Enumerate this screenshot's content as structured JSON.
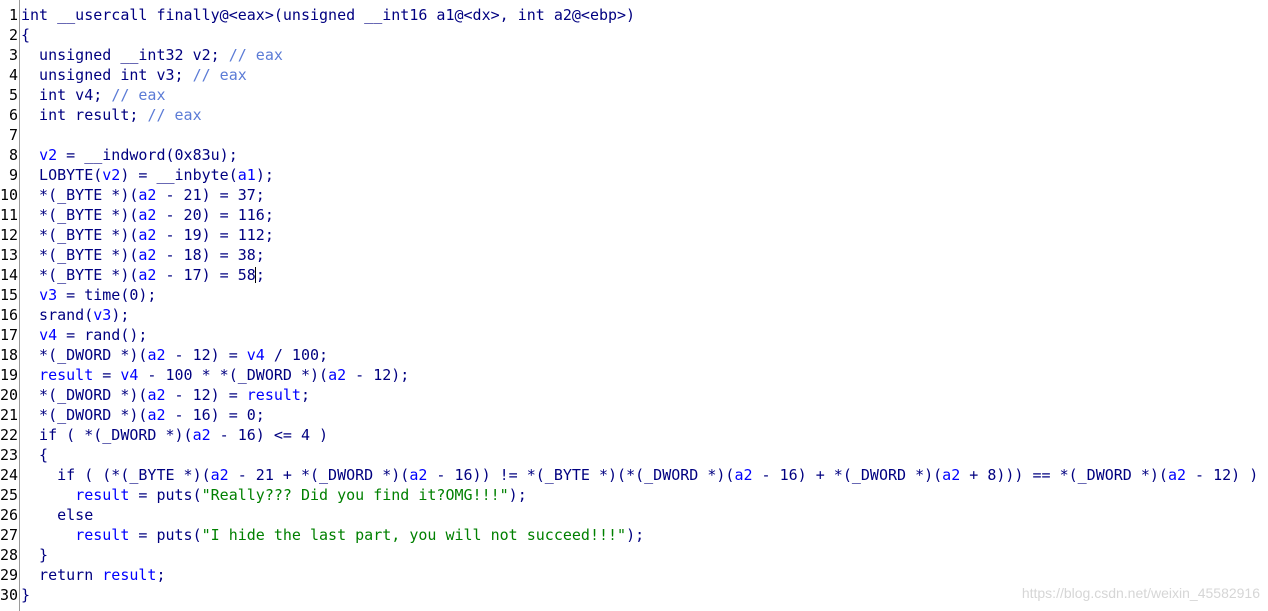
{
  "colors": {
    "background": "#ffffff",
    "plain": "#000080",
    "variable": "#0000ff",
    "comment": "#5b7bd6",
    "string": "#008000",
    "dim": "#808080"
  },
  "editor": {
    "line_numbers": [
      "1",
      "2",
      "3",
      "4",
      "5",
      "6",
      "7",
      "8",
      "9",
      "10",
      "11",
      "12",
      "13",
      "14",
      "15",
      "16",
      "17",
      "18",
      "19",
      "20",
      "21",
      "22",
      "23",
      "24",
      "25",
      "26",
      "27",
      "28",
      "29",
      "30"
    ],
    "lines": [
      [
        {
          "t": "int __usercall finally@<eax>(unsigned __int16 a1@<dx>, int a2@<ebp>)",
          "c": "plain"
        }
      ],
      [
        {
          "t": "{",
          "c": "plain"
        }
      ],
      [
        {
          "t": "  unsigned __int32 v2; ",
          "c": "plain"
        },
        {
          "t": "// eax",
          "c": "comment"
        }
      ],
      [
        {
          "t": "  unsigned int v3; ",
          "c": "plain"
        },
        {
          "t": "// eax",
          "c": "comment"
        }
      ],
      [
        {
          "t": "  int v4; ",
          "c": "plain"
        },
        {
          "t": "// eax",
          "c": "comment"
        }
      ],
      [
        {
          "t": "  int result; ",
          "c": "plain"
        },
        {
          "t": "// eax",
          "c": "comment"
        }
      ],
      [
        {
          "t": "",
          "c": "plain"
        }
      ],
      [
        {
          "t": "  ",
          "c": "plain"
        },
        {
          "t": "v2",
          "c": "var"
        },
        {
          "t": " = __indword(0x83u);",
          "c": "plain"
        }
      ],
      [
        {
          "t": "  LOBYTE(",
          "c": "plain"
        },
        {
          "t": "v2",
          "c": "var"
        },
        {
          "t": ") = __inbyte(",
          "c": "plain"
        },
        {
          "t": "a1",
          "c": "var"
        },
        {
          "t": ");",
          "c": "plain"
        }
      ],
      [
        {
          "t": "  *(_BYTE *)(",
          "c": "plain"
        },
        {
          "t": "a2",
          "c": "var"
        },
        {
          "t": " - 21) = 37;",
          "c": "plain"
        }
      ],
      [
        {
          "t": "  *(_BYTE *)(",
          "c": "plain"
        },
        {
          "t": "a2",
          "c": "var"
        },
        {
          "t": " - 20) = 116;",
          "c": "plain"
        }
      ],
      [
        {
          "t": "  *(_BYTE *)(",
          "c": "plain"
        },
        {
          "t": "a2",
          "c": "var"
        },
        {
          "t": " - 19) = 112;",
          "c": "plain"
        }
      ],
      [
        {
          "t": "  *(_BYTE *)(",
          "c": "plain"
        },
        {
          "t": "a2",
          "c": "var"
        },
        {
          "t": " - 18) = 38;",
          "c": "plain"
        }
      ],
      [
        {
          "t": "  *(_BYTE *)(",
          "c": "plain"
        },
        {
          "t": "a2",
          "c": "var"
        },
        {
          "t": " - 17) = 58",
          "c": "plain"
        },
        {
          "t": "",
          "c": "caret"
        },
        {
          "t": ";",
          "c": "plain"
        }
      ],
      [
        {
          "t": "  ",
          "c": "plain"
        },
        {
          "t": "v3",
          "c": "var"
        },
        {
          "t": " = time(0);",
          "c": "plain"
        }
      ],
      [
        {
          "t": "  srand(",
          "c": "plain"
        },
        {
          "t": "v3",
          "c": "var"
        },
        {
          "t": ");",
          "c": "plain"
        }
      ],
      [
        {
          "t": "  ",
          "c": "plain"
        },
        {
          "t": "v4",
          "c": "var"
        },
        {
          "t": " = rand();",
          "c": "plain"
        }
      ],
      [
        {
          "t": "  *(_DWORD *)(",
          "c": "plain"
        },
        {
          "t": "a2",
          "c": "var"
        },
        {
          "t": " - 12) = ",
          "c": "plain"
        },
        {
          "t": "v4",
          "c": "var"
        },
        {
          "t": " / 100;",
          "c": "plain"
        }
      ],
      [
        {
          "t": "  ",
          "c": "plain"
        },
        {
          "t": "result",
          "c": "var"
        },
        {
          "t": " = ",
          "c": "plain"
        },
        {
          "t": "v4",
          "c": "var"
        },
        {
          "t": " - 100 * *(_DWORD *)(",
          "c": "plain"
        },
        {
          "t": "a2",
          "c": "var"
        },
        {
          "t": " - 12);",
          "c": "plain"
        }
      ],
      [
        {
          "t": "  *(_DWORD *)(",
          "c": "plain"
        },
        {
          "t": "a2",
          "c": "var"
        },
        {
          "t": " - 12) = ",
          "c": "plain"
        },
        {
          "t": "result",
          "c": "var"
        },
        {
          "t": ";",
          "c": "plain"
        }
      ],
      [
        {
          "t": "  *(_DWORD *)(",
          "c": "plain"
        },
        {
          "t": "a2",
          "c": "var"
        },
        {
          "t": " - 16) = 0;",
          "c": "plain"
        }
      ],
      [
        {
          "t": "  if ( *(_DWORD *)(",
          "c": "plain"
        },
        {
          "t": "a2",
          "c": "var"
        },
        {
          "t": " - 16) <= 4 )",
          "c": "plain"
        }
      ],
      [
        {
          "t": "  {",
          "c": "plain"
        }
      ],
      [
        {
          "t": "    if ( (*(_BYTE *)(",
          "c": "plain"
        },
        {
          "t": "a2",
          "c": "var"
        },
        {
          "t": " - 21 + *(_DWORD *)(",
          "c": "plain"
        },
        {
          "t": "a2",
          "c": "var"
        },
        {
          "t": " - 16)) != *(_BYTE *)(*(_DWORD *)(",
          "c": "plain"
        },
        {
          "t": "a2",
          "c": "var"
        },
        {
          "t": " - 16) + *(_DWORD *)(",
          "c": "plain"
        },
        {
          "t": "a2",
          "c": "var"
        },
        {
          "t": " + 8))) == *(_DWORD *)(",
          "c": "plain"
        },
        {
          "t": "a2",
          "c": "var"
        },
        {
          "t": " - 12) )",
          "c": "plain"
        }
      ],
      [
        {
          "t": "      ",
          "c": "plain"
        },
        {
          "t": "result",
          "c": "var"
        },
        {
          "t": " = puts(",
          "c": "plain"
        },
        {
          "t": "\"Really??? Did you find it?OMG!!!\"",
          "c": "str"
        },
        {
          "t": ");",
          "c": "plain"
        }
      ],
      [
        {
          "t": "    else",
          "c": "plain"
        }
      ],
      [
        {
          "t": "      ",
          "c": "plain"
        },
        {
          "t": "result",
          "c": "var"
        },
        {
          "t": " = puts(",
          "c": "plain"
        },
        {
          "t": "\"I hide the last part, you will not succeed!!!\"",
          "c": "str"
        },
        {
          "t": ");",
          "c": "plain"
        }
      ],
      [
        {
          "t": "  }",
          "c": "plain"
        }
      ],
      [
        {
          "t": "  return ",
          "c": "plain"
        },
        {
          "t": "result",
          "c": "var"
        },
        {
          "t": ";",
          "c": "plain"
        }
      ],
      [
        {
          "t": "}",
          "c": "plain"
        }
      ]
    ]
  },
  "watermark": "https://blog.csdn.net/weixin_45582916"
}
